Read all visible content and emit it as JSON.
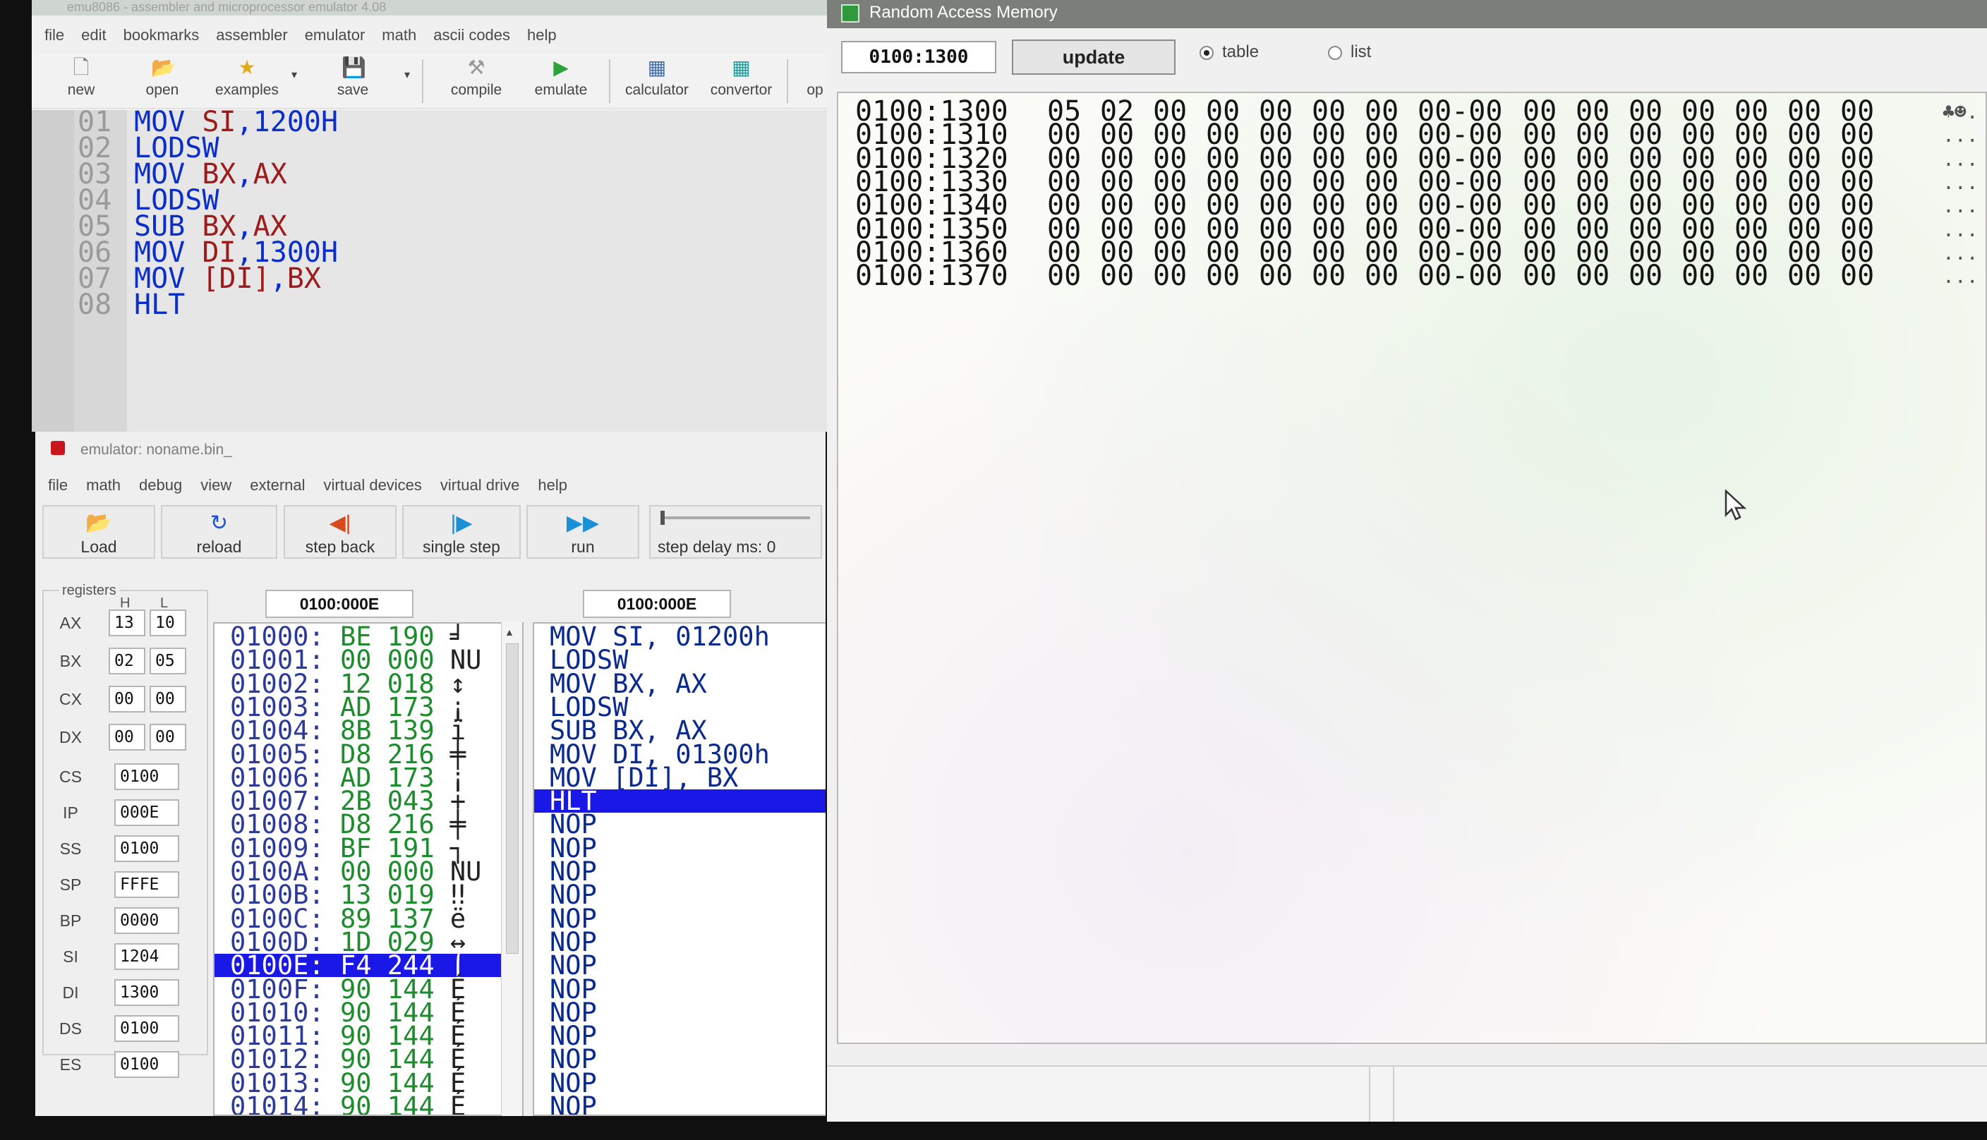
{
  "editor": {
    "title": "emu8086 - assembler and microprocessor emulator 4.08",
    "menu": [
      "file",
      "edit",
      "bookmarks",
      "assembler",
      "emulator",
      "math",
      "ascii codes",
      "help"
    ],
    "toolbar": {
      "new": "new",
      "open": "open",
      "examples": "examples",
      "save": "save",
      "compile": "compile",
      "emulate": "emulate",
      "calculator": "calculator",
      "convertor": "convertor",
      "options": "op"
    },
    "code_lines": [
      {
        "n": "01",
        "op": "MOV",
        "args": [
          {
            "t": "SI",
            "k": "rg"
          },
          {
            "t": ",",
            "k": "p"
          },
          {
            "t": "1200H",
            "k": "nm"
          }
        ]
      },
      {
        "n": "02",
        "op": "LODSW",
        "args": []
      },
      {
        "n": "03",
        "op": "MOV",
        "args": [
          {
            "t": "BX",
            "k": "rg"
          },
          {
            "t": ",",
            "k": "p"
          },
          {
            "t": "AX",
            "k": "rg"
          }
        ]
      },
      {
        "n": "04",
        "op": "LODSW",
        "args": []
      },
      {
        "n": "05",
        "op": "SUB",
        "args": [
          {
            "t": "BX",
            "k": "rg"
          },
          {
            "t": ",",
            "k": "p"
          },
          {
            "t": "AX",
            "k": "rg"
          }
        ]
      },
      {
        "n": "06",
        "op": "MOV",
        "args": [
          {
            "t": "DI",
            "k": "rg"
          },
          {
            "t": ",",
            "k": "p"
          },
          {
            "t": "1300H",
            "k": "nm"
          }
        ]
      },
      {
        "n": "07",
        "op": "MOV",
        "args": [
          {
            "t": "[DI]",
            "k": "rg"
          },
          {
            "t": ",",
            "k": "p"
          },
          {
            "t": "BX",
            "k": "rg"
          }
        ]
      },
      {
        "n": "08",
        "op": "HLT",
        "args": []
      }
    ]
  },
  "emulator": {
    "title": "emulator: noname.bin_",
    "menu": [
      "file",
      "math",
      "debug",
      "view",
      "external",
      "virtual devices",
      "virtual drive",
      "help"
    ],
    "buttons": {
      "load": "Load",
      "reload": "reload",
      "step_back": "step back",
      "single_step": "single step",
      "run": "run"
    },
    "step_delay_label": "step delay ms: 0",
    "registers_label": "registers",
    "h_label": "H",
    "l_label": "L",
    "split_registers": [
      {
        "name": "AX",
        "h": "13",
        "l": "10"
      },
      {
        "name": "BX",
        "h": "02",
        "l": "05"
      },
      {
        "name": "CX",
        "h": "00",
        "l": "00"
      },
      {
        "name": "DX",
        "h": "00",
        "l": "00"
      }
    ],
    "registers": [
      {
        "name": "CS",
        "value": "0100"
      },
      {
        "name": "IP",
        "value": "000E"
      },
      {
        "name": "SS",
        "value": "0100"
      },
      {
        "name": "SP",
        "value": "FFFE"
      },
      {
        "name": "BP",
        "value": "0000"
      },
      {
        "name": "SI",
        "value": "1204"
      },
      {
        "name": "DI",
        "value": "1300"
      },
      {
        "name": "DS",
        "value": "0100"
      },
      {
        "name": "ES",
        "value": "0100"
      }
    ],
    "memory_address": "0100:000E",
    "disasm_address": "0100:000E",
    "memory_rows": [
      {
        "addr": "01000:",
        "hex": "BE",
        "dec": "190",
        "ch": "╛"
      },
      {
        "addr": "01001:",
        "hex": "00",
        "dec": "000",
        "ch": "NU"
      },
      {
        "addr": "01002:",
        "hex": "12",
        "dec": "018",
        "ch": "↕"
      },
      {
        "addr": "01003:",
        "hex": "AD",
        "dec": "173",
        "ch": "¡"
      },
      {
        "addr": "01004:",
        "hex": "8B",
        "dec": "139",
        "ch": "ï"
      },
      {
        "addr": "01005:",
        "hex": "D8",
        "dec": "216",
        "ch": "╪"
      },
      {
        "addr": "01006:",
        "hex": "AD",
        "dec": "173",
        "ch": "¡"
      },
      {
        "addr": "01007:",
        "hex": "2B",
        "dec": "043",
        "ch": "+"
      },
      {
        "addr": "01008:",
        "hex": "D8",
        "dec": "216",
        "ch": "╪"
      },
      {
        "addr": "01009:",
        "hex": "BF",
        "dec": "191",
        "ch": "┐"
      },
      {
        "addr": "0100A:",
        "hex": "00",
        "dec": "000",
        "ch": "NU"
      },
      {
        "addr": "0100B:",
        "hex": "13",
        "dec": "019",
        "ch": "‼"
      },
      {
        "addr": "0100C:",
        "hex": "89",
        "dec": "137",
        "ch": "ë"
      },
      {
        "addr": "0100D:",
        "hex": "1D",
        "dec": "029",
        "ch": "↔"
      },
      {
        "addr": "0100E:",
        "hex": "F4",
        "dec": "244",
        "ch": "⌠"
      },
      {
        "addr": "0100F:",
        "hex": "90",
        "dec": "144",
        "ch": "É"
      },
      {
        "addr": "01010:",
        "hex": "90",
        "dec": "144",
        "ch": "É"
      },
      {
        "addr": "01011:",
        "hex": "90",
        "dec": "144",
        "ch": "É"
      },
      {
        "addr": "01012:",
        "hex": "90",
        "dec": "144",
        "ch": "É"
      },
      {
        "addr": "01013:",
        "hex": "90",
        "dec": "144",
        "ch": "É"
      },
      {
        "addr": "01014:",
        "hex": "90",
        "dec": "144",
        "ch": "É"
      }
    ],
    "selected_memory_row": 14,
    "disasm_rows": [
      "MOV SI, 01200h",
      "LODSW",
      "MOV BX, AX",
      "LODSW",
      "SUB BX, AX",
      "MOV DI, 01300h",
      "MOV [DI], BX",
      "HLT",
      "NOP",
      "NOP",
      "NOP",
      "NOP",
      "NOP",
      "NOP",
      "NOP",
      "NOP",
      "NOP",
      "NOP",
      "NOP",
      "NOP",
      "NOP"
    ],
    "selected_disasm_row": 7
  },
  "ram": {
    "title": "Random Access Memory",
    "address": "0100:1300",
    "update_label": "update",
    "table_label": "table",
    "list_label": "list",
    "view_mode": "table",
    "rows": [
      {
        "addr": "0100:1300",
        "bytes": [
          "05",
          "02",
          "00",
          "00",
          "00",
          "00",
          "00",
          "00-00",
          "00",
          "00",
          "00",
          "00",
          "00",
          "00",
          "00"
        ],
        "ascii": "♣☻."
      },
      {
        "addr": "0100:1310",
        "bytes": [
          "00",
          "00",
          "00",
          "00",
          "00",
          "00",
          "00",
          "00-00",
          "00",
          "00",
          "00",
          "00",
          "00",
          "00",
          "00"
        ],
        "ascii": "..."
      },
      {
        "addr": "0100:1320",
        "bytes": [
          "00",
          "00",
          "00",
          "00",
          "00",
          "00",
          "00",
          "00-00",
          "00",
          "00",
          "00",
          "00",
          "00",
          "00",
          "00"
        ],
        "ascii": "..."
      },
      {
        "addr": "0100:1330",
        "bytes": [
          "00",
          "00",
          "00",
          "00",
          "00",
          "00",
          "00",
          "00-00",
          "00",
          "00",
          "00",
          "00",
          "00",
          "00",
          "00"
        ],
        "ascii": "..."
      },
      {
        "addr": "0100:1340",
        "bytes": [
          "00",
          "00",
          "00",
          "00",
          "00",
          "00",
          "00",
          "00-00",
          "00",
          "00",
          "00",
          "00",
          "00",
          "00",
          "00"
        ],
        "ascii": "..."
      },
      {
        "addr": "0100:1350",
        "bytes": [
          "00",
          "00",
          "00",
          "00",
          "00",
          "00",
          "00",
          "00-00",
          "00",
          "00",
          "00",
          "00",
          "00",
          "00",
          "00"
        ],
        "ascii": "..."
      },
      {
        "addr": "0100:1360",
        "bytes": [
          "00",
          "00",
          "00",
          "00",
          "00",
          "00",
          "00",
          "00-00",
          "00",
          "00",
          "00",
          "00",
          "00",
          "00",
          "00"
        ],
        "ascii": "..."
      },
      {
        "addr": "0100:1370",
        "bytes": [
          "00",
          "00",
          "00",
          "00",
          "00",
          "00",
          "00",
          "00-00",
          "00",
          "00",
          "00",
          "00",
          "00",
          "00",
          "00"
        ],
        "ascii": "..."
      }
    ]
  },
  "colors": {
    "selection": "#1a18e6",
    "keyword": "#0b2ec8",
    "register": "#9e1b1b",
    "hex_value": "#1c8c2c"
  }
}
